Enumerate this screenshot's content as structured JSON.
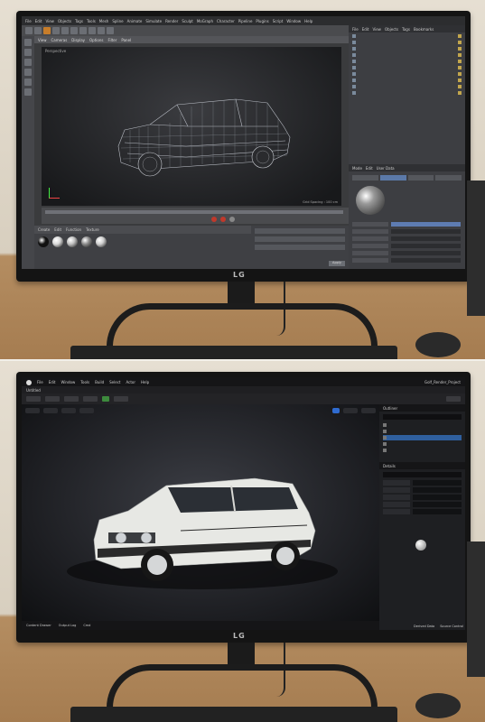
{
  "top": {
    "brand": "LG",
    "c4d": {
      "menu": [
        "File",
        "Edit",
        "View",
        "Objects",
        "Tags",
        "Tools",
        "Mesh",
        "Spline",
        "Animate",
        "Simulate",
        "Render",
        "Sculpt",
        "MoGraph",
        "Character",
        "Pipeline",
        "Plugins",
        "Script",
        "Window",
        "Help"
      ],
      "viewport_menu": [
        "View",
        "Cameras",
        "Display",
        "Options",
        "Filter",
        "Panel"
      ],
      "viewport_label": "Perspective",
      "grid_spacing": "Grid Spacing : 100 cm",
      "material_tabs": [
        "Create",
        "Edit",
        "Function",
        "Texture"
      ],
      "object_manager_tabs": [
        "File",
        "Edit",
        "View",
        "Objects",
        "Tags",
        "Bookmarks"
      ],
      "attr_tabs": [
        "Mode",
        "Edit",
        "User Data"
      ],
      "apply_label": "Apply",
      "material_colors": [
        "#111111",
        "#d9d9d9",
        "#bfbfbf",
        "#8c8c8c",
        "#cfcfcf"
      ]
    }
  },
  "bottom": {
    "brand": "LG",
    "ue": {
      "menu": [
        "File",
        "Edit",
        "Window",
        "Tools",
        "Build",
        "Select",
        "Actor",
        "Help"
      ],
      "project": "Golf_Render_Project",
      "level_tab": "Untitled",
      "outliner_title": "Outliner",
      "details_title": "Details",
      "bottom_items": [
        "Content Drawer",
        "Output Log",
        "Cmd"
      ],
      "status_right": [
        "Derived Data",
        "Source Control"
      ],
      "accent": "#2f6bd0"
    }
  }
}
